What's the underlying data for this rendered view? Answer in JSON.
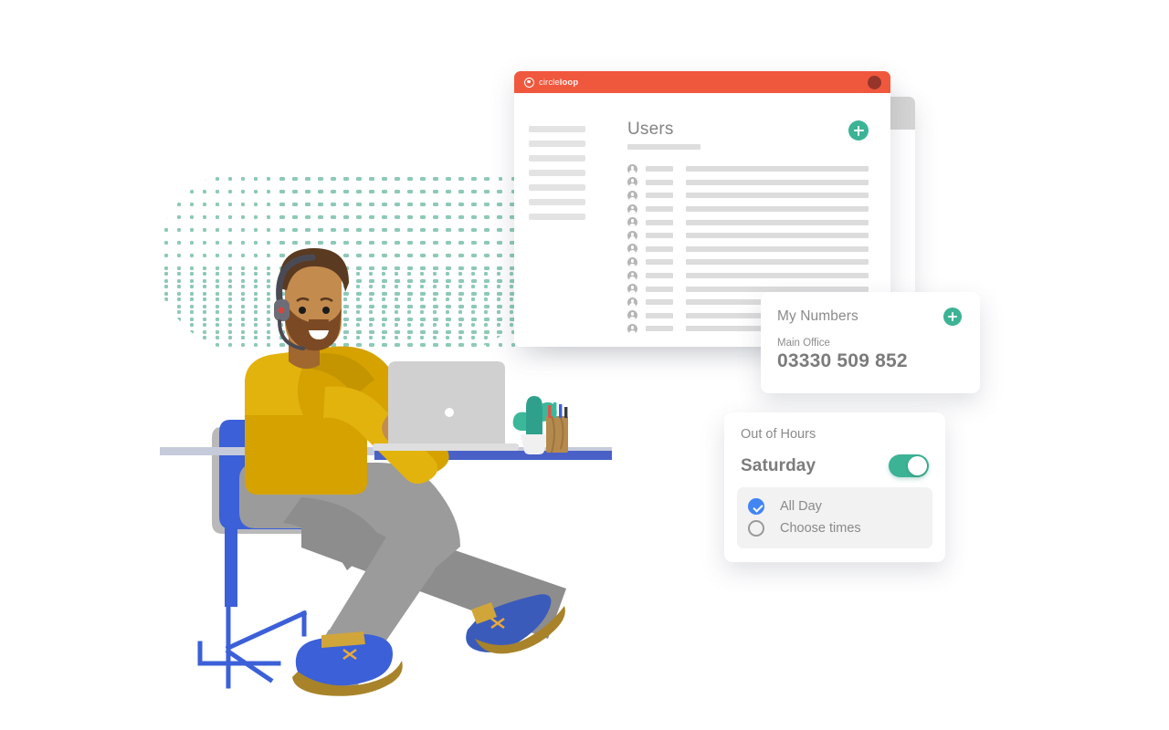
{
  "window": {
    "brand_prefix": "circle",
    "brand_suffix": "loop",
    "close_button": "window-close-dot",
    "main": {
      "title": "Users",
      "add_button_label": "+",
      "row_count": 13
    },
    "sidebar_item_count": 7
  },
  "cards": {
    "numbers": {
      "title": "My Numbers",
      "add_button_label": "+",
      "line_label": "Main Office",
      "number": "03330 509 852"
    },
    "out_of_hours": {
      "title": "Out of Hours",
      "day": "Saturday",
      "toggle_state": "on",
      "options": [
        {
          "label": "All Day",
          "selected": true
        },
        {
          "label": "Choose times",
          "selected": false
        }
      ]
    }
  },
  "colors": {
    "brand_orange": "#f0583e",
    "accent_green": "#3cb395",
    "radio_blue": "#4285f4",
    "dot_teal": "#8ec9b8",
    "sweater_yellow": "#d5a200",
    "chair_blue": "#3b60d8",
    "trousers_gray": "#9b9b9b"
  },
  "illustration": {
    "scene": "man-with-headset-at-desk-using-laptop",
    "objects": [
      "headset",
      "laptop",
      "cactus-plant",
      "pen-holder",
      "desk",
      "office-chair",
      "shoes"
    ]
  }
}
